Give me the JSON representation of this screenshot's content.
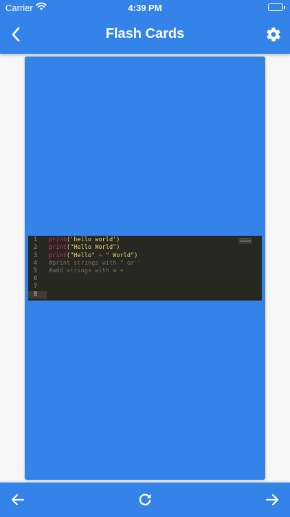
{
  "status_bar": {
    "carrier": "Carrier",
    "time": "4:39 PM"
  },
  "nav": {
    "title": "Flash Cards",
    "back_icon": "chevron-left-icon",
    "settings_icon": "gear-icon"
  },
  "colors": {
    "primary": "#3383e8",
    "background": "#f7f7f7",
    "code_bg": "#272822"
  },
  "card": {
    "code_lines": [
      {
        "no": "1",
        "segments": [
          {
            "t": "print",
            "c": "kw"
          },
          {
            "t": "('hello world')",
            "c": "str"
          }
        ]
      },
      {
        "no": "2",
        "segments": [
          {
            "t": "print",
            "c": "kw"
          },
          {
            "t": "(\"Hello World\")",
            "c": "str"
          }
        ]
      },
      {
        "no": "3",
        "segments": [
          {
            "t": "print",
            "c": "kw"
          },
          {
            "t": "(\"Hello\" ",
            "c": "str"
          },
          {
            "t": "+",
            "c": "op"
          },
          {
            "t": " \" World\")",
            "c": "str"
          }
        ]
      },
      {
        "no": "4",
        "segments": [
          {
            "t": "#print strings with \" or '",
            "c": "comment"
          }
        ]
      },
      {
        "no": "5",
        "segments": [
          {
            "t": "#add strings with a +",
            "c": "comment"
          }
        ]
      },
      {
        "no": "6",
        "segments": []
      },
      {
        "no": "7",
        "segments": []
      },
      {
        "no": "8",
        "segments": [],
        "active": true
      }
    ]
  },
  "bottom_bar": {
    "prev_icon": "arrow-left-icon",
    "reload_icon": "reload-icon",
    "next_icon": "arrow-right-icon"
  }
}
